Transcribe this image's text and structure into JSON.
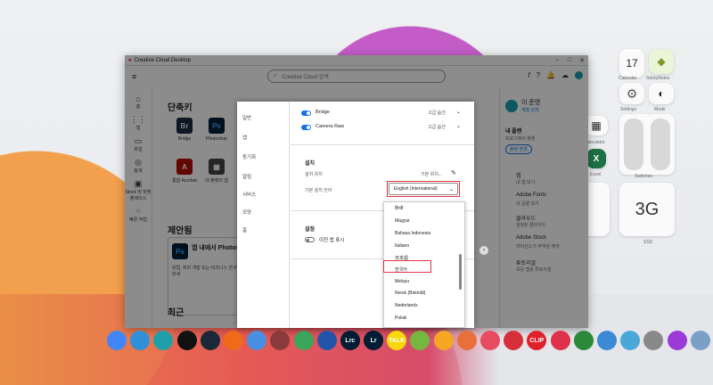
{
  "window": {
    "title": "Creative Cloud Desktop",
    "search_placeholder": "Creative Cloud 검색",
    "controls": [
      "–",
      "□",
      "✕"
    ]
  },
  "left_nav": [
    {
      "label": "홈",
      "icon": "home-icon"
    },
    {
      "label": "앱",
      "icon": "apps-icon"
    },
    {
      "label": "파일",
      "icon": "files-icon"
    },
    {
      "label": "탐색",
      "icon": "discover-icon"
    },
    {
      "label": "Stock 및 마켓플레이스",
      "icon": "stock-icon"
    },
    {
      "label": "빠른 작업",
      "icon": "quick-actions-icon"
    }
  ],
  "main": {
    "shortcuts_title": "단축키",
    "apps": [
      {
        "abbr": "Br",
        "label": "Bridge",
        "color": "#1a2a3f"
      },
      {
        "abbr": "Ps",
        "label": "Photoshop",
        "color": "#001e36"
      },
      {
        "abbr": "A",
        "label": "통합 Acrobat",
        "color": "#b30b00"
      },
      {
        "abbr": "▦",
        "label": "내 플랫의 앱",
        "color": "#444444"
      }
    ],
    "suggest_title": "제안됨",
    "suggest_card_title": "앱 내에서 Photosh 개발",
    "suggest_card_body": "유럽, 취미 개발 또는 비즈니스 한 Photoshop 앱을 살펴보세",
    "recent_title": "최근",
    "recent_filter": "모두"
  },
  "right_panel": {
    "user_name": "이 준명",
    "account_link": "계정 관리",
    "plan_title": "내 플랜",
    "plan_sub": "프로그레이 플랜",
    "plan_button": "플랜 변경",
    "items": [
      {
        "title": "앱",
        "sub": "내 앱 보기"
      },
      {
        "title": "Adobe Fonts",
        "sub": "내 글꼴 보기"
      },
      {
        "title": "클라우드",
        "sub": "설정된 클라우드"
      },
      {
        "title": "Adobe Stock",
        "sub": "라이선스가 부여된 에셋"
      },
      {
        "title": "튜토리얼",
        "sub": "모든 앱용 튜토리얼"
      }
    ]
  },
  "dialog": {
    "nav": [
      "일반",
      "앱",
      "동기화",
      "알림",
      "서비스",
      "모양",
      "홈"
    ],
    "apps": [
      {
        "name": "Bridge",
        "option": "고급 옵션",
        "enabled": true
      },
      {
        "name": "Camera Raw",
        "option": "고급 옵션",
        "enabled": true
      }
    ],
    "install_title": "설치",
    "install_location_label": "설치 위치",
    "install_location_value": "기본 위치...",
    "install_language_label": "기본 설치 언어",
    "install_language_value": "English (International)",
    "settings_title": "설정",
    "settings_toggle_label": "이전 앱 표시"
  },
  "language_dropdown": {
    "options": [
      "हिन्दी",
      "Magyar",
      "Bahasa Indonesia",
      "Italiano",
      "日本語",
      "한국어",
      "Melayu",
      "Norsk (Bokmål)",
      "Nederlands",
      "Polski"
    ],
    "highlighted": "한국어"
  },
  "widgets": {
    "calendar_day": "17",
    "calendar_label": "Calendar",
    "stickynotes_label": "StickyNotes",
    "settings_label": "Settings",
    "mode_label": "Mode",
    "calculator_label": "Calculator",
    "excel_label": "Excel",
    "switches_label": "Switches",
    "ssd_value": "3G",
    "ssd_label": "SSD"
  },
  "dock_apps": [
    {
      "name": "chrome",
      "color": "#4285f4"
    },
    {
      "name": "edge",
      "color": "#2f8fd8"
    },
    {
      "name": "edge-beta",
      "color": "#1fa0a8"
    },
    {
      "name": "opera",
      "color": "#111111"
    },
    {
      "name": "steam",
      "color": "#1b2838"
    },
    {
      "name": "s-app",
      "color": "#f06a1a"
    },
    {
      "name": "butterfly-app",
      "color": "#4a90e2"
    },
    {
      "name": "pdf-app",
      "color": "#8a3a3a"
    },
    {
      "name": "green-app",
      "color": "#3aa55a"
    },
    {
      "name": "chip-app",
      "color": "#2255aa"
    },
    {
      "name": "lrc",
      "color": "#001d34"
    },
    {
      "name": "lr",
      "color": "#001d34"
    },
    {
      "name": "talk",
      "color": "#f5d90a"
    },
    {
      "name": "utorrent",
      "color": "#76b83f"
    },
    {
      "name": "play",
      "color": "#f5a623"
    },
    {
      "name": "photo-app",
      "color": "#e8703a"
    },
    {
      "name": "camera-app",
      "color": "#e84a5f"
    },
    {
      "name": "crop-app",
      "color": "#d62f3a"
    },
    {
      "name": "clip-app",
      "color": "#e0202a"
    },
    {
      "name": "player-app",
      "color": "#e0304a"
    },
    {
      "name": "edit-app",
      "color": "#2a8a3a"
    },
    {
      "name": "monitor-app",
      "color": "#3a8ad6"
    },
    {
      "name": "ext-app",
      "color": "#4aa8d8"
    },
    {
      "name": "tools-app",
      "color": "#888888"
    },
    {
      "name": "power-app",
      "color": "#9b3ad6"
    },
    {
      "name": "trash-app",
      "color": "#7aa0c8"
    }
  ],
  "dock_labels": {
    "lrc": "Lrc",
    "lr": "Lr",
    "talk": "TALK",
    "clip": "CLIP"
  }
}
